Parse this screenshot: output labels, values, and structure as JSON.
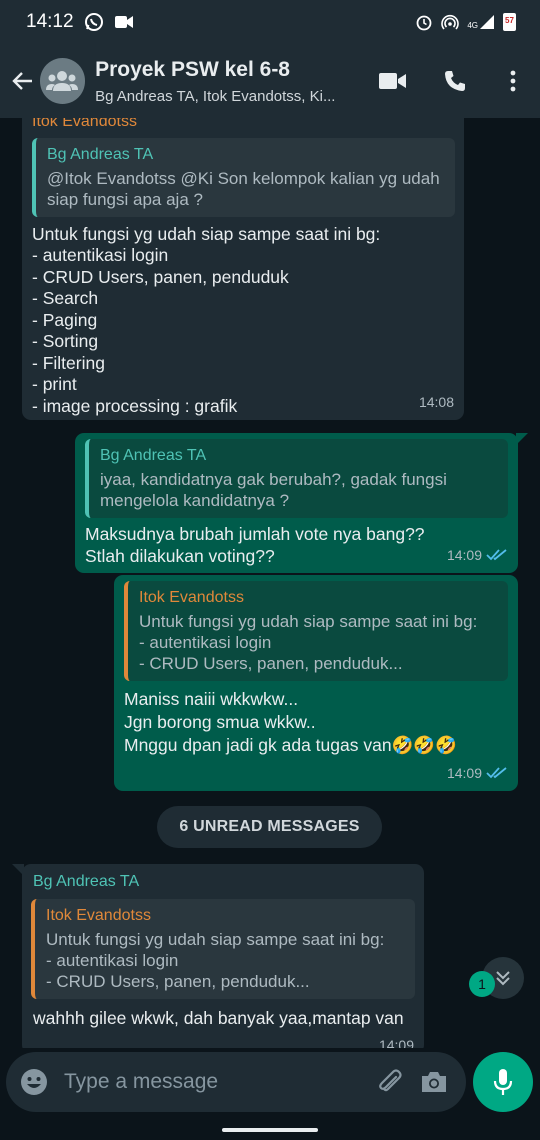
{
  "status_bar": {
    "time": "14:12",
    "left_icons": [
      "whatsapp-icon",
      "video-call-notification-icon"
    ],
    "right_icons": [
      "alarm-icon",
      "hotspot-icon",
      "signal-4g-icon",
      "battery-icon"
    ],
    "network": "4G",
    "battery_level": "57"
  },
  "header": {
    "group_name": "Proyek PSW kel 6-8",
    "members": "Bg Andreas TA, Itok Evandotss, Ki...",
    "icons": [
      "back-arrow-icon",
      "group-avatar-icon",
      "video-call-icon",
      "phone-call-icon",
      "more-options-icon"
    ]
  },
  "messages": [
    {
      "direction": "incoming",
      "sender": "Itok Evandotss",
      "quote_sender": "Bg Andreas TA",
      "quote_text": "@Itok Evandotss  @Ki Son  kelompok kalian yg udah siap fungsi apa aja ?",
      "text": "Untuk fungsi yg udah siap sampe saat ini bg:\n- autentikasi login\n- CRUD Users, panen,  penduduk\n- Search\n- Paging\n- Sorting\n- Filtering\n- print\n- image processing : grafik",
      "time": "14:08"
    },
    {
      "direction": "outgoing",
      "quote_sender": "Bg Andreas TA",
      "quote_text": "iyaa, kandidatnya gak berubah?, gadak fungsi mengelola kandidatnya ?",
      "text": "Maksudnya brubah jumlah vote nya bang??\nStlah dilakukan voting??",
      "time": "14:09",
      "status": "read"
    },
    {
      "direction": "outgoing",
      "quote_sender": "Itok Evandotss",
      "quote_text": "Untuk fungsi yg udah siap sampe saat ini bg:\n- autentikasi login\n- CRUD Users, panen,  penduduk...",
      "text": "Maniss naiii wkkwkw...\nJgn borong smua wkkw..\nMnggu dpan jadi gk ada tugas van🤣🤣🤣",
      "time": "14:09",
      "status": "read"
    },
    {
      "direction": "incoming",
      "sender": "Bg Andreas TA",
      "quote_sender": "Itok Evandotss",
      "quote_text": "Untuk fungsi yg udah siap sampe saat ini bg:\n- autentikasi login\n- CRUD Users, panen,  penduduk...",
      "text": "wahhh gilee wkwk, dah banyak yaa,mantap van",
      "time": "14:09"
    }
  ],
  "unread_divider": "6 UNREAD MESSAGES",
  "scroll_down": {
    "badge": "1",
    "icon": "double-chevron-down-icon"
  },
  "composer": {
    "placeholder": "Type a message",
    "icons": [
      "emoji-icon",
      "attach-icon",
      "camera-icon",
      "mic-icon"
    ]
  },
  "colors": {
    "background": "#0b141a",
    "bar": "#1f2c34",
    "incoming_bubble": "#1f2c34",
    "outgoing_bubble": "#005c4b",
    "accent": "#00a884",
    "read_ticks": "#53bdeb",
    "orange_name": "#e0883a",
    "teal_name": "#4fc3b5"
  }
}
